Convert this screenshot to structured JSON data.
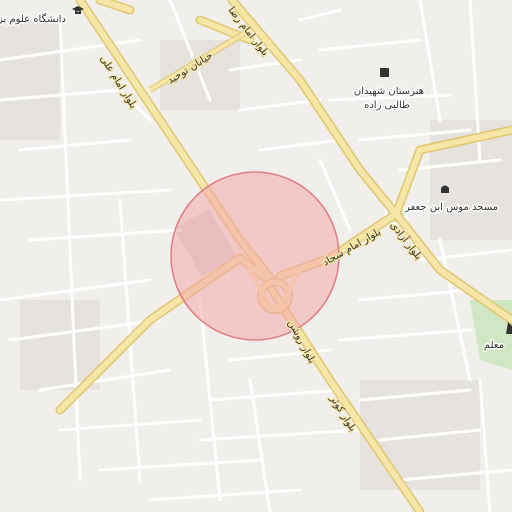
{
  "map": {
    "colors": {
      "background": "#f1efeb",
      "minor_road": "#ffffff",
      "major_road_fill": "#f6e6a8",
      "major_road_casing": "#e2c770",
      "park": "#cfe7c3",
      "building_block": "#e3e0db",
      "radius_fill": "#f4a7ab",
      "radius_stroke": "#e27d84"
    },
    "roads": {
      "imam_ali": "بلوار امام علی",
      "imam_reza": "بلوار امام رضا",
      "imam_sajjad": "بلوار امام سجاد",
      "azadi": "بلوار آزادی",
      "kowsar": "بلوار کوثر",
      "rowshan": "بلوار روشن",
      "towhid": "خیابان توحید"
    },
    "pois": [
      {
        "name": "دانشگاه علوم پز",
        "icon": "graduation-cap-icon"
      },
      {
        "name_line1": "هنرستان شهیدان",
        "name_line2": "طالبی زاده",
        "icon": "school-icon"
      },
      {
        "name": "مسجد موس ابن جعفر",
        "icon": "mosque-icon"
      },
      {
        "name": "معلم",
        "icon": "park-icon"
      }
    ],
    "highlight": {
      "type": "radius",
      "shape": "circle"
    }
  }
}
